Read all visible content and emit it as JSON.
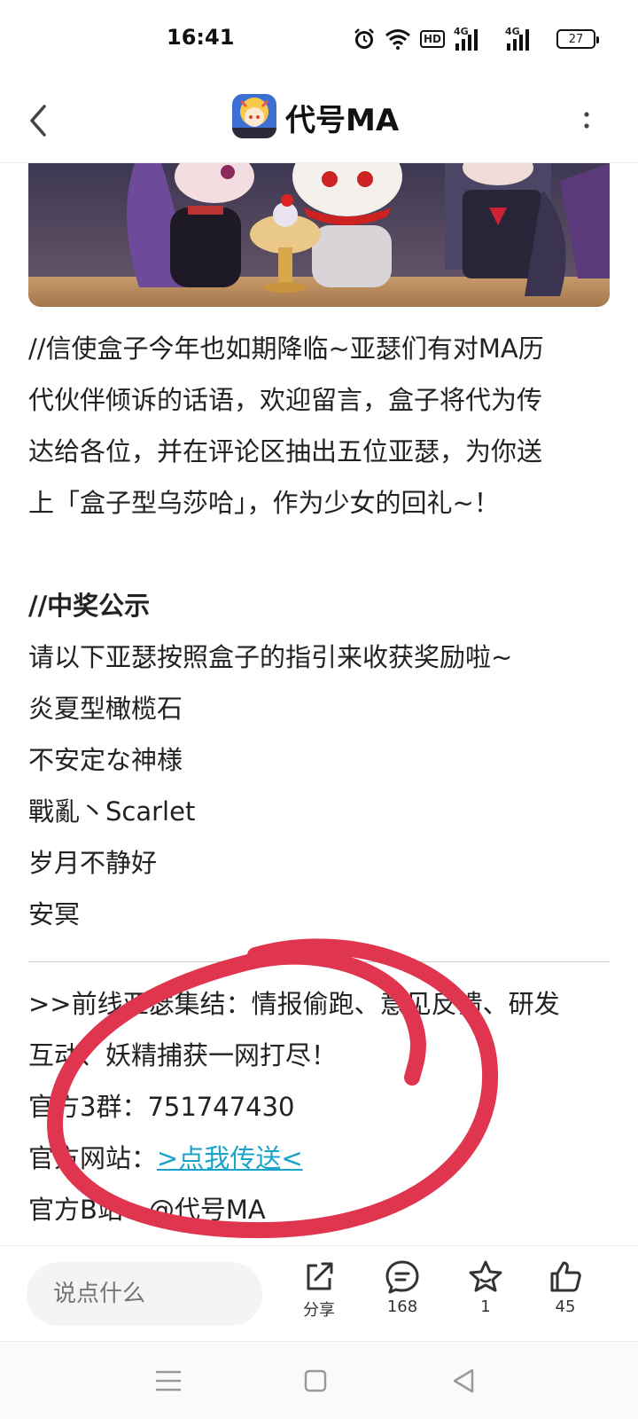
{
  "status_bar": {
    "time": "16:41",
    "hd_label": "HD",
    "net1": "4G",
    "net2": "4G",
    "battery": "27",
    "icons": [
      "alarm-icon",
      "wifi-icon",
      "hd-icon",
      "signal-icon",
      "signal-icon",
      "battery-icon"
    ]
  },
  "header": {
    "title": "代号MA",
    "back_icon": "chevron-left-icon",
    "more_icon": "more-vertical-icon"
  },
  "content": {
    "intro_lines": [
      "//信使盒子今年也如期降临~亚瑟们有对MA历",
      "代伙伴倾诉的话语，欢迎留言，盒子将代为传",
      "达给各位，并在评论区抽出五位亚瑟，为你送",
      "上「盒子型乌莎哈」，作为少女的回礼~！"
    ],
    "winners_heading": "//中奖公示",
    "winners_intro": "请以下亚瑟按照盒子的指引来收获奖励啦~",
    "winners": [
      "炎夏型橄榄石",
      "不安定な神様",
      "戰亂丶Scarlet",
      "岁月不静好",
      "安冥"
    ],
    "footer_lines": [
      ">>前线亚瑟集结：情报偷跑、意见反馈、研发",
      "互动、妖精捕获一网打尽！"
    ],
    "group_label": "官方3群：",
    "group_number": "751747430",
    "site_label": "官方网站：",
    "site_link": ">点我传送<",
    "bili_label": "官方B站：",
    "bili_value": "@代号MA"
  },
  "action_bar": {
    "comment_placeholder": "说点什么",
    "share_label": "分享",
    "comments_count": "168",
    "favorites_count": "1",
    "likes_count": "45"
  },
  "colors": {
    "link": "#1aa3c9",
    "annotation": "#e0354f"
  }
}
